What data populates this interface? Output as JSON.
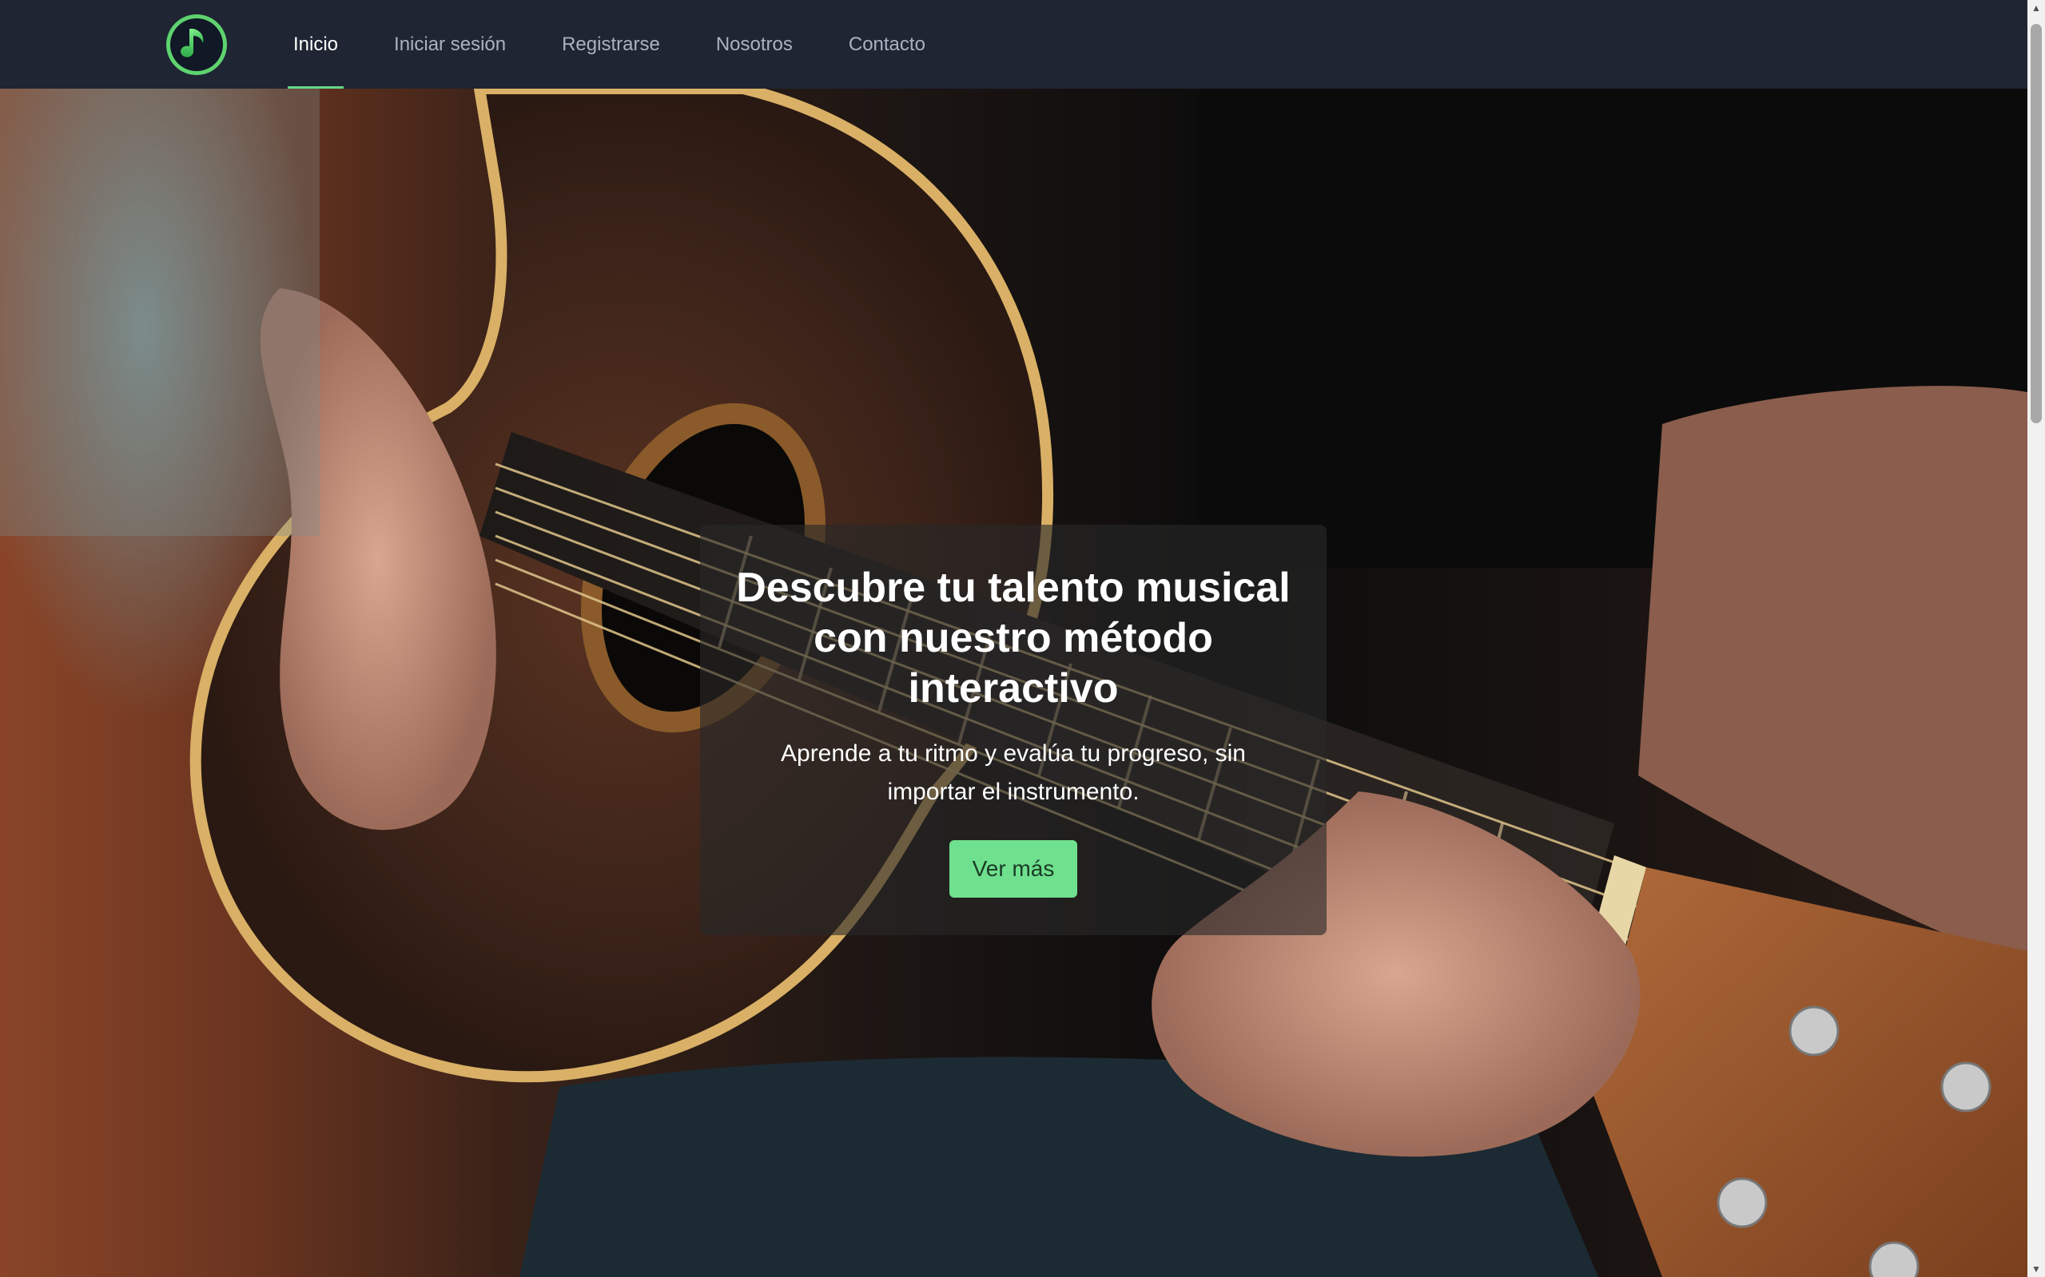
{
  "nav": {
    "logo_icon": "music-note-icon",
    "links": [
      {
        "label": "Inicio",
        "active": true
      },
      {
        "label": "Iniciar sesión",
        "active": false
      },
      {
        "label": "Registrarse",
        "active": false
      },
      {
        "label": "Nosotros",
        "active": false
      },
      {
        "label": "Contacto",
        "active": false
      }
    ]
  },
  "hero": {
    "background_image": "acoustic-guitar-player-photo",
    "title": "Descubre tu talento musical con nuestro método interactivo",
    "subtitle": "Aprende a tu ritmo y evalúa tu progreso, sin importar el instrumento.",
    "cta_label": "Ver más"
  },
  "colors": {
    "navbar_bg": "#1f2533",
    "accent_green": "#6fe08e",
    "nav_active_text": "#ffffff",
    "nav_inactive_text": "#aab2c0"
  }
}
